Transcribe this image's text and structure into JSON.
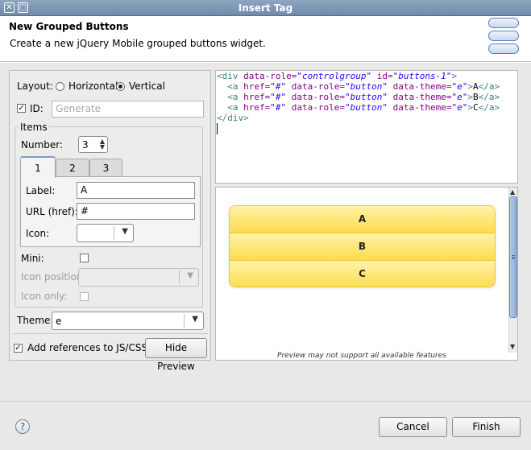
{
  "window": {
    "title": "Insert Tag"
  },
  "header": {
    "title": "New Grouped Buttons",
    "description": "Create a new jQuery Mobile grouped buttons widget."
  },
  "form": {
    "layout_label": "Layout:",
    "layout_options": [
      "Horizontal",
      "Vertical"
    ],
    "layout_selected": "Vertical",
    "id_label": "ID:",
    "id_checked": true,
    "id_placeholder": "Generate",
    "items_group_label": "Items",
    "number_label": "Number:",
    "number_value": "3",
    "tabs": [
      "1",
      "2",
      "3"
    ],
    "active_tab": "1",
    "label_label": "Label:",
    "label_value": "A",
    "url_label": "URL (href):",
    "url_value": "#",
    "icon_label": "Icon:",
    "icon_value": "",
    "mini_label": "Mini:",
    "mini_checked": false,
    "icon_position_label": "Icon position:",
    "icon_position_value": "",
    "icon_only_label": "Icon only:",
    "icon_only_checked": false,
    "theme_label": "Theme:",
    "theme_value": "e",
    "add_refs_label": "Add references to JS/CSS",
    "add_refs_checked": true,
    "hide_preview_label": "Hide Preview"
  },
  "code": {
    "line1_open": "<div ",
    "line1_attr1": "data-role=",
    "line1_val1": "\"controlgroup\"",
    "line1_attr2": " id=",
    "line1_val2": "\"buttons-1\"",
    "line1_close": ">",
    "lines": [
      {
        "text": "A"
      },
      {
        "text": "B"
      },
      {
        "text": "C"
      }
    ],
    "a_open": "  <a ",
    "a_attr1": "href=",
    "a_val1": "\"#\"",
    "a_attr2": " data-role=",
    "a_val2": "\"button\"",
    "a_attr3": " data-theme=",
    "a_val3": "\"e\"",
    "a_gt": ">",
    "a_close": "</a>",
    "end_tag": "</div>"
  },
  "preview": {
    "buttons": [
      "A",
      "B",
      "C"
    ],
    "note": "Preview may not support all available features"
  },
  "footer": {
    "help_symbol": "?",
    "cancel_label": "Cancel",
    "finish_label": "Finish"
  },
  "colors": {
    "titlebar": "#7b93b3",
    "jq_yellow_top": "#fff3a6",
    "jq_yellow_bottom": "#fcdc4e",
    "jq_border": "#f2c43d"
  }
}
